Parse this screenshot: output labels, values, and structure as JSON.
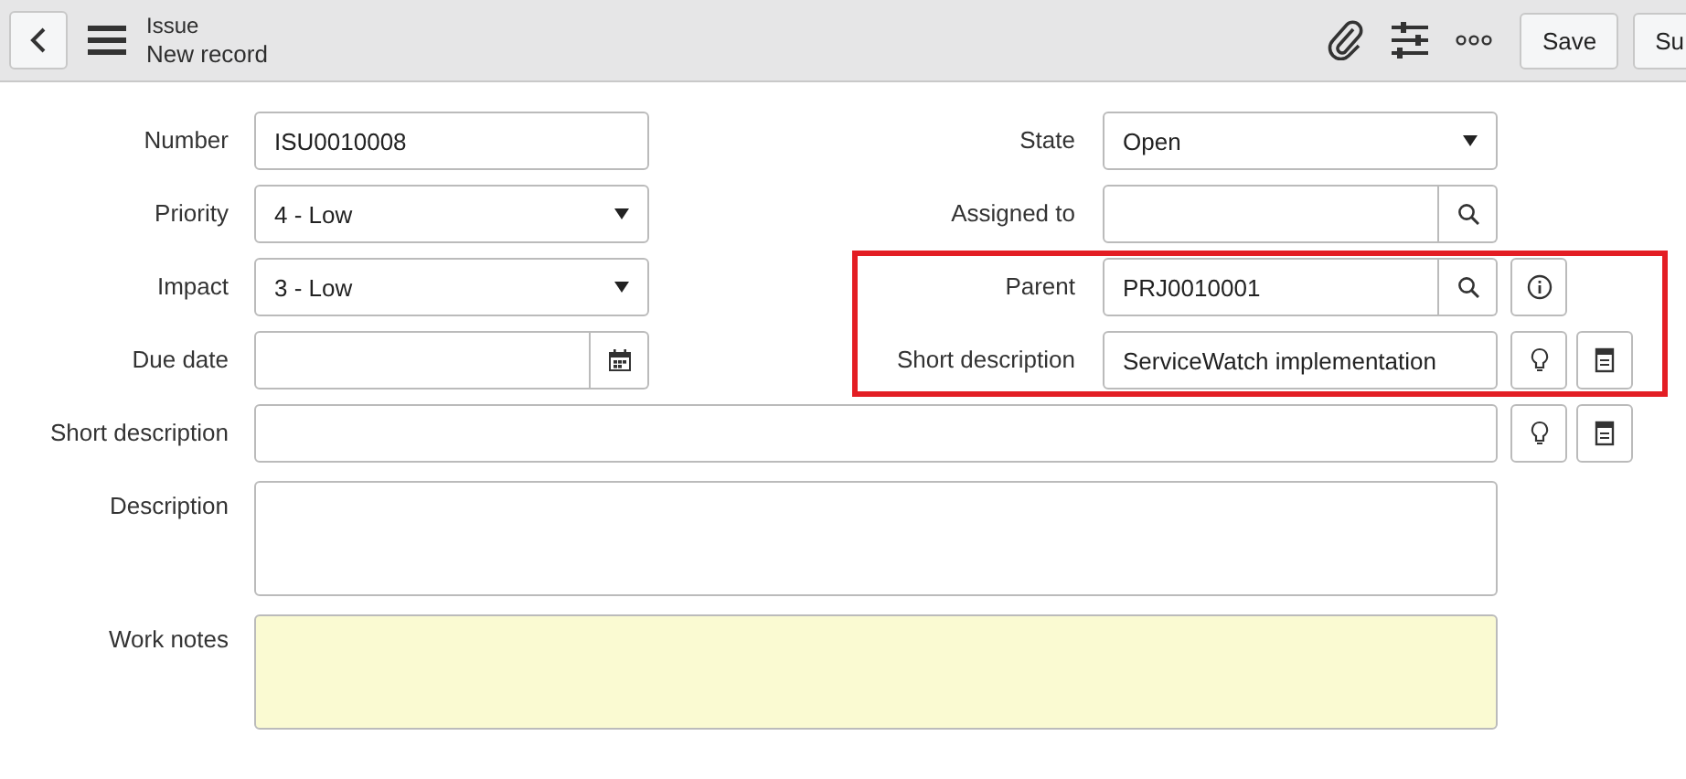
{
  "header": {
    "title": "Issue",
    "subtitle": "New record",
    "buttons": [
      "Save",
      "Su"
    ]
  },
  "rows": [
    {
      "left": {
        "label": "Number",
        "kind": "text",
        "value": "ISU0010008",
        "highlighted": false
      },
      "right": {
        "label": "State",
        "kind": "select",
        "value": "Open",
        "highlighted": false
      }
    },
    {
      "left": {
        "label": "Priority",
        "kind": "select",
        "value": "4 - Low",
        "highlighted": false
      },
      "right": {
        "label": "Assigned to",
        "kind": "reference",
        "highlighted": false
      }
    },
    {
      "left": {
        "label": "Impact",
        "kind": "select",
        "value": "3 - Low",
        "highlighted": false
      },
      "right": {
        "label": "Parent",
        "kind": "reference",
        "value": "PRJ0010001",
        "actions": [
          {
            "kind": "info"
          }
        ],
        "highlighted": true
      }
    },
    {
      "left": {
        "label": "Due date",
        "kind": "date",
        "highlighted": false
      },
      "right": {
        "label": "Short description",
        "kind": "text",
        "value": "ServiceWatch implementation",
        "actions": [
          {
            "kind": "suggest"
          },
          {
            "kind": "template"
          }
        ],
        "highlighted": true
      }
    },
    {
      "wide": {
        "label": "Short description",
        "kind": "text",
        "actions": [
          {
            "kind": "suggest"
          },
          {
            "kind": "template"
          }
        ],
        "highlighted": false
      }
    },
    {
      "wide": {
        "label": "Description",
        "kind": "textarea",
        "highlighted": false
      }
    },
    {
      "wide": {
        "label": "Work notes",
        "kind": "journal",
        "highlighted": false
      }
    }
  ]
}
